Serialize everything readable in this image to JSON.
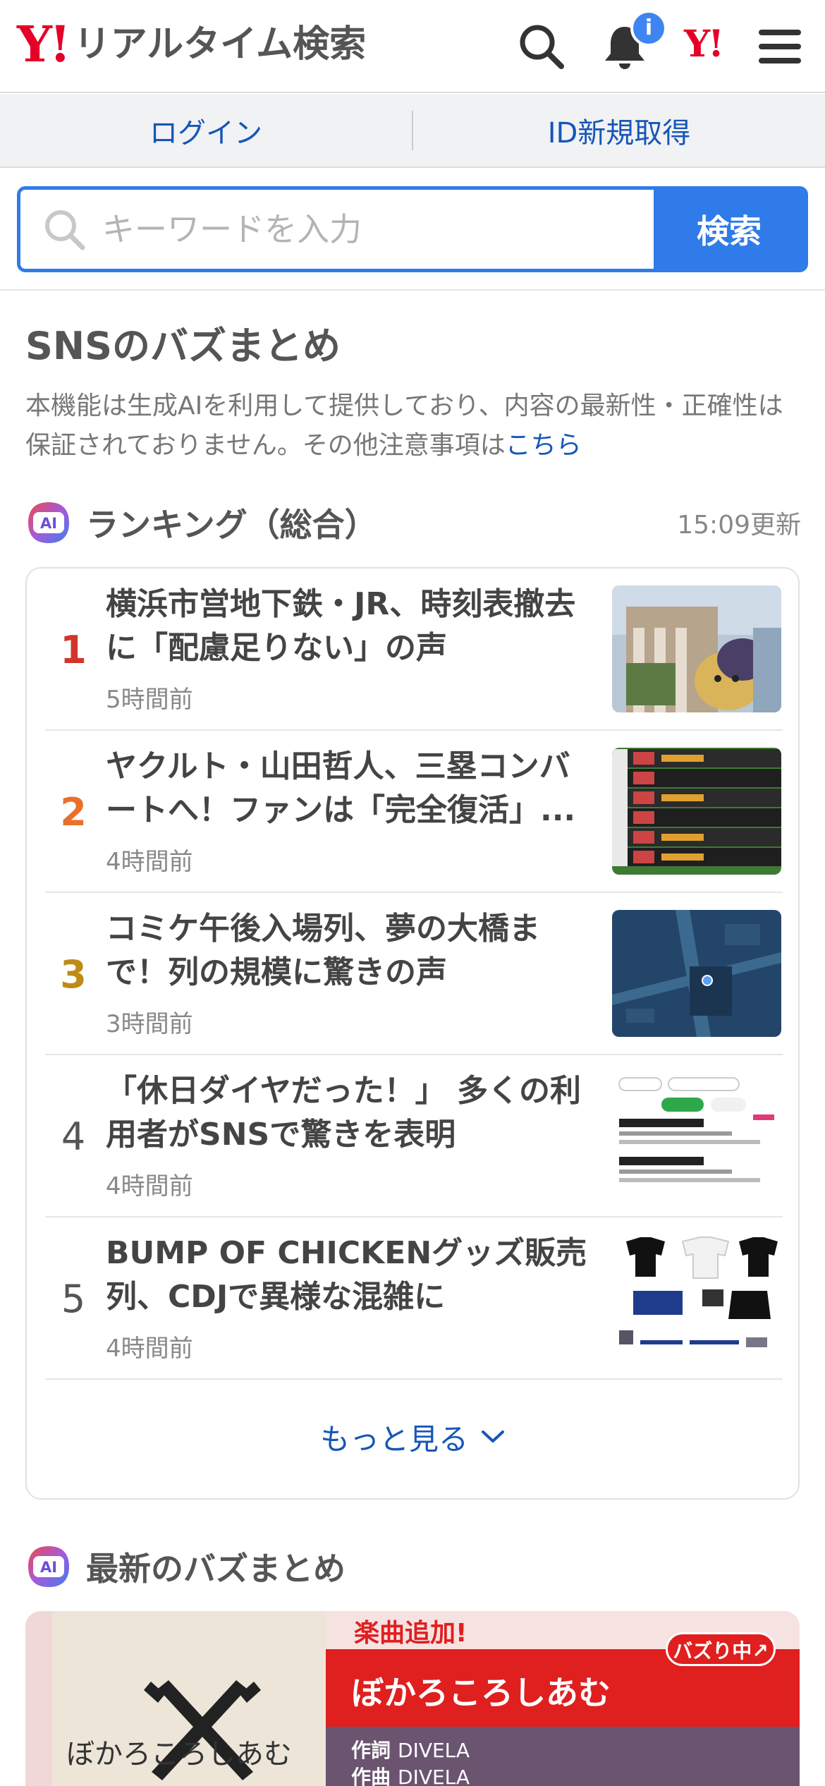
{
  "header": {
    "logo_mark": "Y!",
    "logo_text": "リアルタイム検索",
    "notification_badge": "i",
    "yahoo_mark": "Y!"
  },
  "account": {
    "login_label": "ログイン",
    "register_label": "ID新規取得"
  },
  "search": {
    "placeholder": "キーワードを入力",
    "button_label": "検索"
  },
  "section": {
    "title": "SNSのバズまとめ",
    "notice_text": "本機能は生成AIを利用して提供しており、内容の最新性・正確性は保証されておりません。その他注意事項は",
    "notice_link": "こちら"
  },
  "ranking": {
    "ai_label": "AI",
    "title": "ランキング（総合）",
    "updated": "15:09更新",
    "items": [
      {
        "rank": "1",
        "title": "横浜市営地下鉄・JR、時刻表撤去に「配慮足りない」の声",
        "time": "5時間前"
      },
      {
        "rank": "2",
        "title": "ヤクルト・山田哲人、三塁コンバートへ！ファンは「完全復活」...",
        "time": "4時間前"
      },
      {
        "rank": "3",
        "title": "コミケ午後入場列、夢の大橋まで！列の規模に驚きの声",
        "time": "3時間前"
      },
      {
        "rank": "4",
        "title": "「休日ダイヤだった！」 多くの利用者がSNSで驚きを表明",
        "time": "4時間前"
      },
      {
        "rank": "5",
        "title": "BUMP OF CHICKENグッズ販売列、CDJで異様な混雑に",
        "time": "4時間前"
      }
    ],
    "more_label": "もっと見る"
  },
  "latest": {
    "ai_label": "AI",
    "title": "最新のバズまとめ",
    "banner": {
      "add_label": "楽曲追加!",
      "buzz_badge": "バズり中↗",
      "song_title": "ぼかろころしあむ",
      "left_text": "ぼかろころしあむ",
      "lyrics_label": "作詞",
      "lyrics_value": "DIVELA",
      "music_label": "作曲",
      "music_value": "DIVELA"
    }
  },
  "colors": {
    "brand_red": "#e50027",
    "accent_blue": "#2f7bea",
    "link_blue": "#1656b8",
    "rank1": "#d2352c",
    "rank2": "#e9702b",
    "rank3": "#c08a17"
  }
}
